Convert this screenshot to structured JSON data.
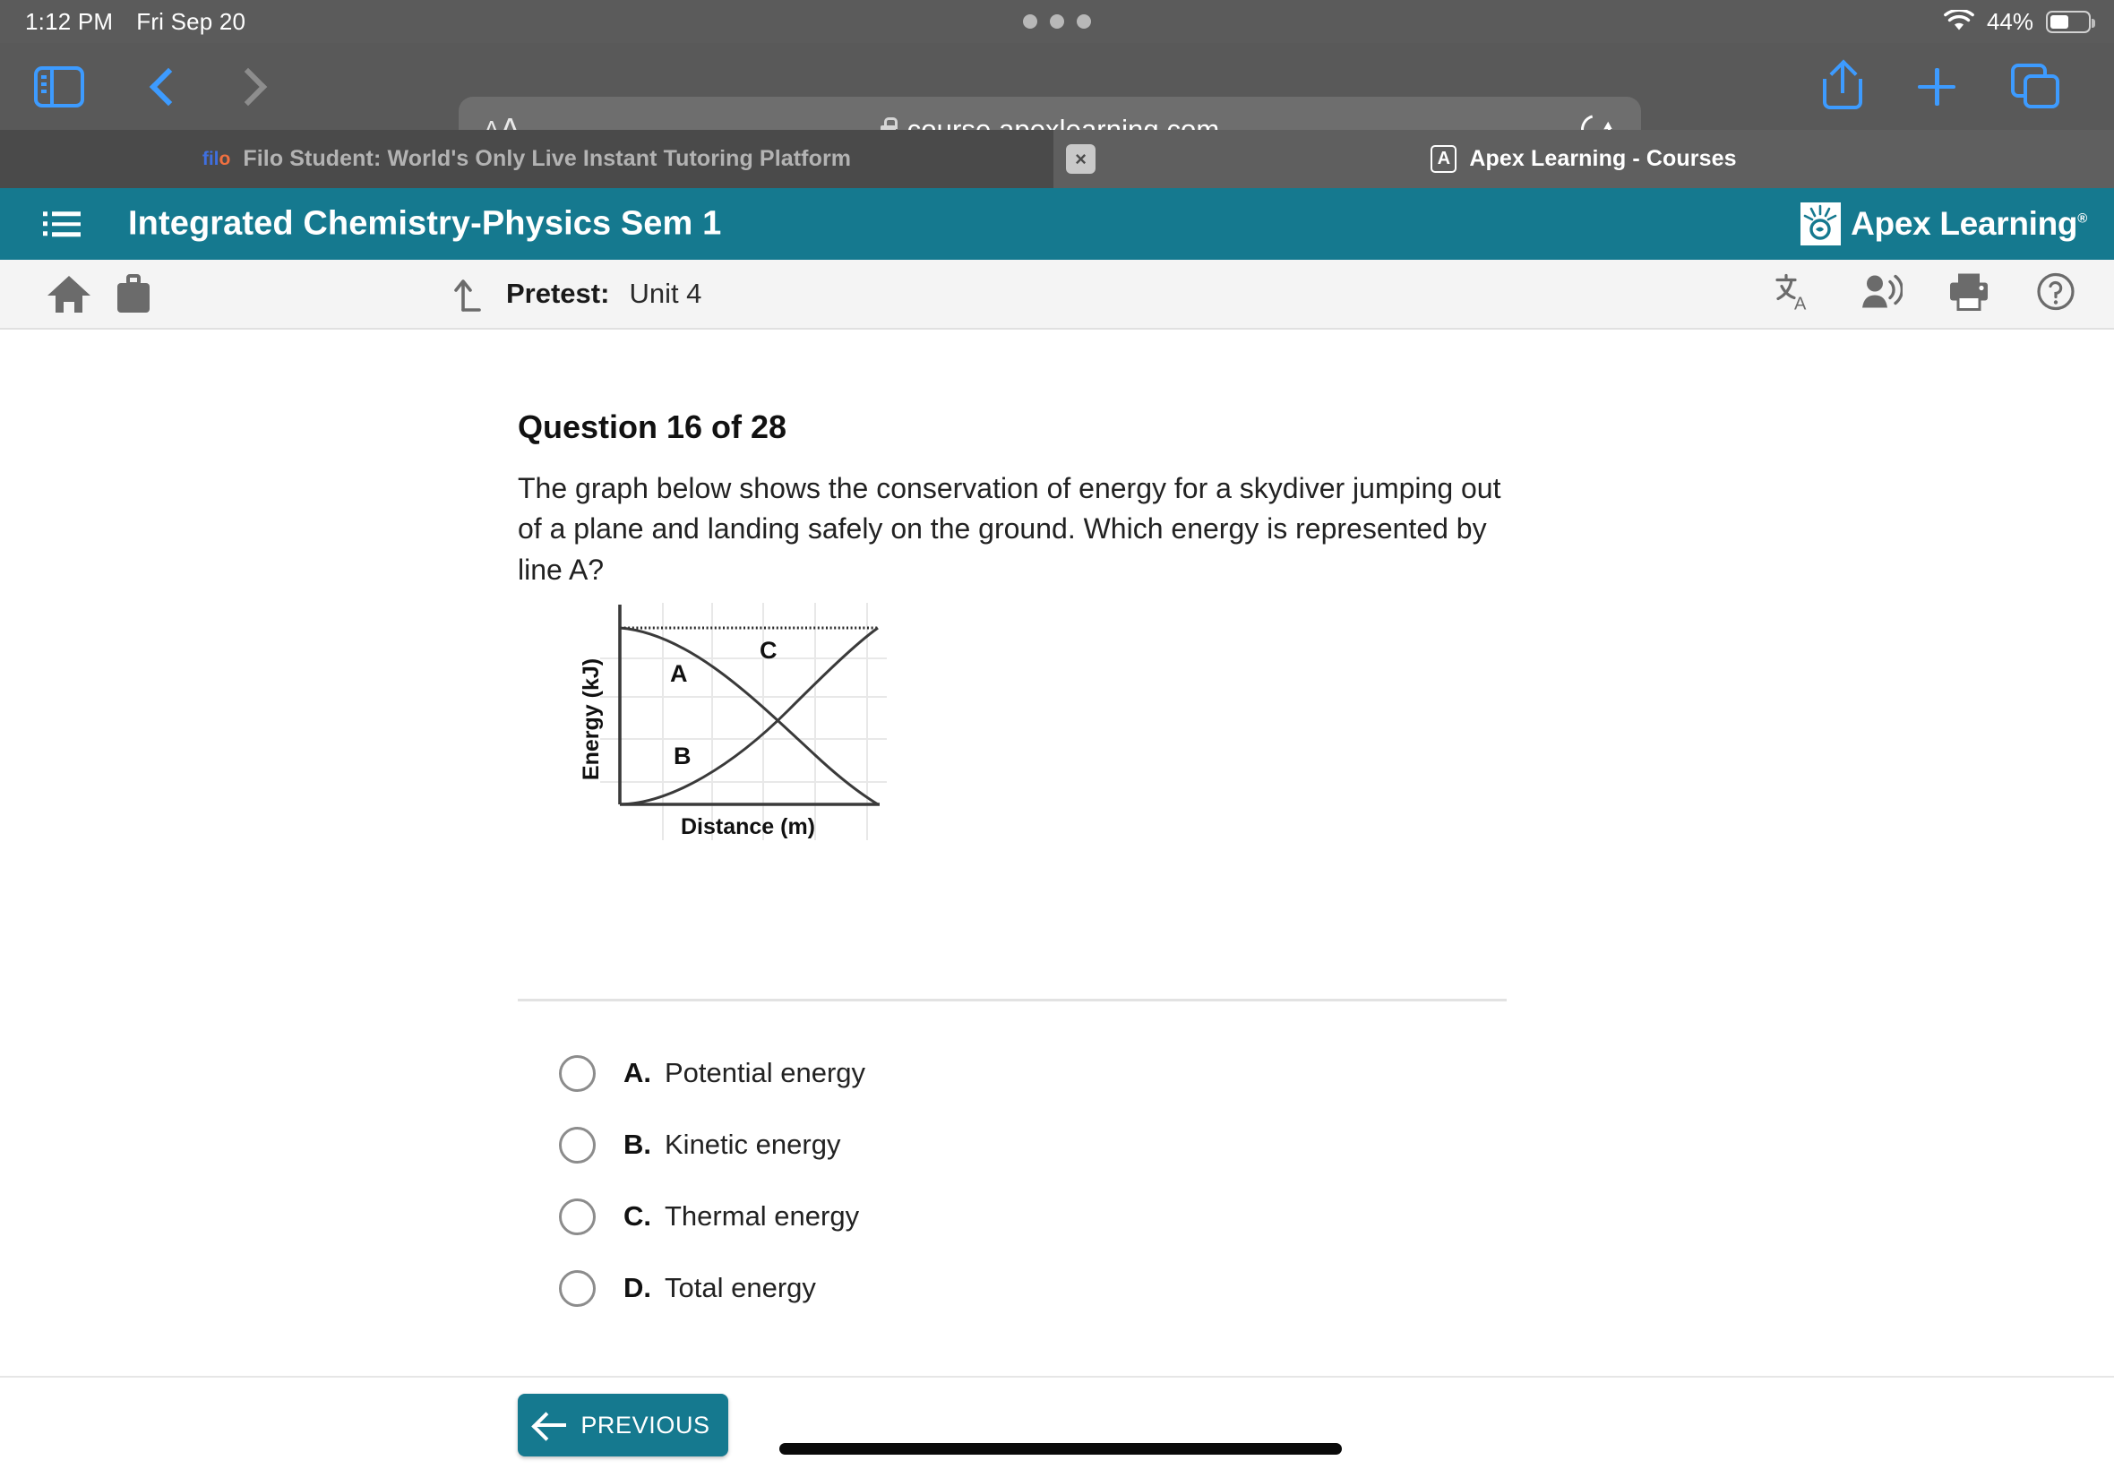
{
  "status_bar": {
    "time": "1:12 PM",
    "date": "Fri Sep 20",
    "battery_percent": "44%",
    "wifi_icon": "wifi-icon",
    "battery_icon": "battery-icon",
    "multitask_dots": "multitask-dots-icon"
  },
  "browser": {
    "sidebar_icon": "sidebar-icon",
    "back_icon": "chevron-left-icon",
    "forward_icon": "chevron-right-icon",
    "text_size_small": "A",
    "text_size_large": "A",
    "lock_icon": "lock-icon",
    "url": "course.apexlearning.com",
    "reload_icon": "reload-icon",
    "share_icon": "share-icon",
    "new_tab_icon": "plus-icon",
    "tabs_overview_icon": "tabs-overview-icon",
    "tabs": [
      {
        "title": "Filo Student: World's Only Live Instant Tutoring Platform",
        "favicon_text": "filo",
        "favicon": "filo-favicon",
        "active": false,
        "close_label": "×"
      },
      {
        "title": "Apex Learning - Courses",
        "favicon_text": "A",
        "favicon": "apex-favicon",
        "active": true
      }
    ]
  },
  "app_header": {
    "menu_icon": "hamburger-menu-icon",
    "course_title": "Integrated Chemistry-Physics Sem 1",
    "brand_name": "Apex Learning",
    "brand_trademark": "®",
    "brand_mark_icon": "apex-sunburst-logo-icon",
    "background_color": "#15798f"
  },
  "sub_toolbar": {
    "home_icon": "home-icon",
    "briefcase_icon": "briefcase-icon",
    "activity_icon": "activity-up-arrow-icon",
    "activity_type": "Pretest:",
    "activity_name": "Unit 4",
    "translate_icon": "translate-icon",
    "read_aloud_icon": "read-aloud-icon",
    "print_icon": "print-icon",
    "help_icon": "help-icon"
  },
  "question": {
    "heading": "Question 16 of 28",
    "number": 16,
    "total": 28,
    "text": "The graph below shows the conservation of energy for a skydiver jumping out of a plane and landing safely on the ground. Which energy is represented by line A?"
  },
  "chart_data": {
    "type": "line",
    "title": "",
    "xlabel": "Distance (m)",
    "ylabel": "Energy (kJ)",
    "xlim": [
      0,
      1
    ],
    "ylim": [
      0,
      1
    ],
    "grid": true,
    "tick_labels_x": [],
    "tick_labels_y": [],
    "annotations": [
      {
        "label": "A",
        "x": 0.27,
        "y": 0.71
      },
      {
        "label": "B",
        "x": 0.31,
        "y": 0.27
      },
      {
        "label": "C",
        "x": 0.62,
        "y": 0.86
      }
    ],
    "series": [
      {
        "name": "A",
        "style": "solid",
        "description": "decreasing concave curve from top-left to bottom-right",
        "x": [
          0.0,
          0.125,
          0.25,
          0.375,
          0.5,
          0.625,
          0.75,
          0.875,
          1.0
        ],
        "y": [
          1.0,
          0.985,
          0.94,
          0.855,
          0.75,
          0.605,
          0.44,
          0.24,
          0.0
        ]
      },
      {
        "name": "B",
        "style": "solid",
        "description": "increasing convex curve from bottom-left to top-right",
        "x": [
          0.0,
          0.125,
          0.25,
          0.375,
          0.5,
          0.625,
          0.75,
          0.875,
          1.0
        ],
        "y": [
          0.0,
          0.015,
          0.06,
          0.145,
          0.25,
          0.395,
          0.56,
          0.76,
          1.0
        ]
      },
      {
        "name": "C",
        "style": "dotted",
        "description": "constant horizontal line at maximum energy",
        "x": [
          0.0,
          1.0
        ],
        "y": [
          1.0,
          1.0
        ]
      }
    ]
  },
  "options": [
    {
      "letter": "A.",
      "text": "Potential energy",
      "selected": false
    },
    {
      "letter": "B.",
      "text": "Kinetic energy",
      "selected": false
    },
    {
      "letter": "C.",
      "text": "Thermal energy",
      "selected": false
    },
    {
      "letter": "D.",
      "text": "Total energy",
      "selected": false
    }
  ],
  "footer": {
    "previous_label": "PREVIOUS",
    "previous_icon": "arrow-left-icon",
    "button_color": "#15798f",
    "home_indicator": "home-indicator"
  }
}
